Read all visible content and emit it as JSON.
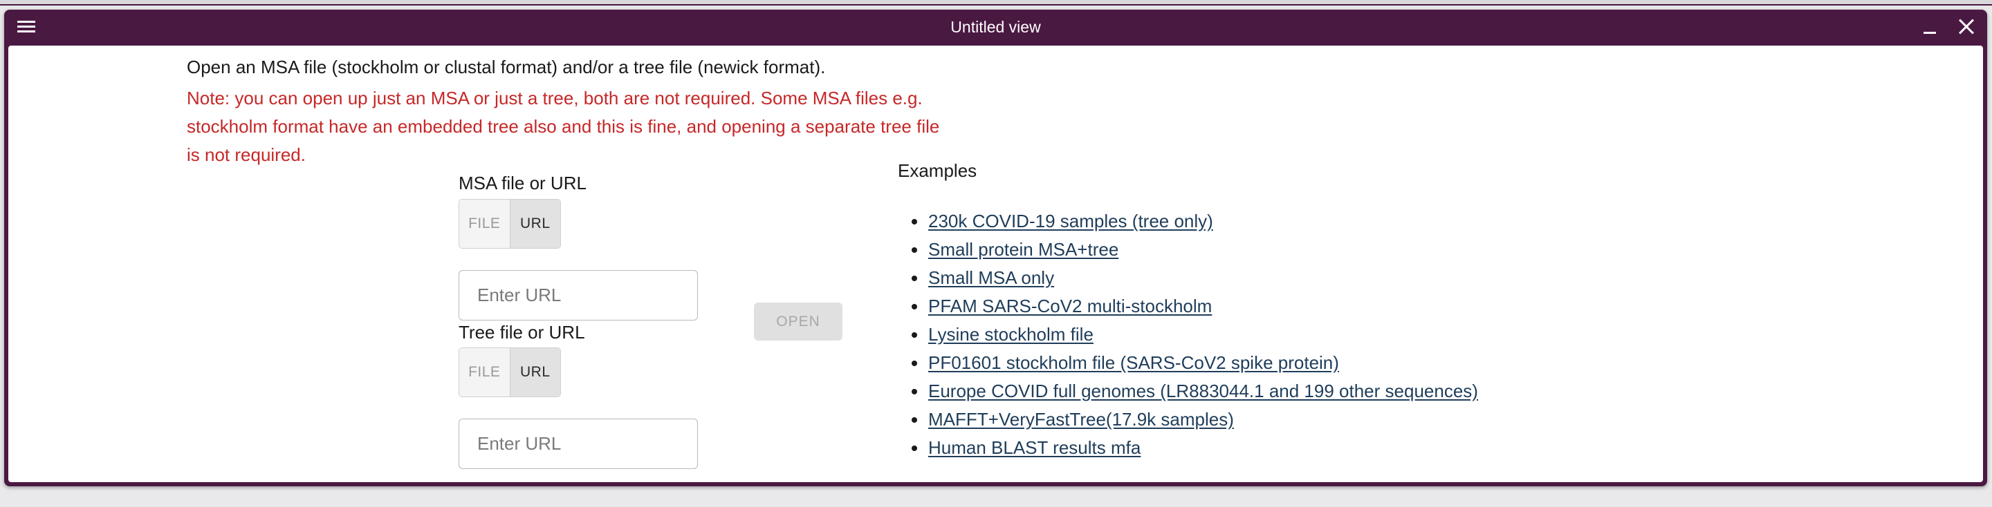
{
  "window": {
    "title": "Untitled view"
  },
  "intro": {
    "text": "Open an MSA file (stockholm or clustal format) and/or a tree file (newick format).",
    "note_lines": [
      "Note: you can open up just an MSA or just a tree, both are not required. Some MSA files e.g.",
      "stockholm format have an embedded tree also and this is fine, and opening a separate tree file",
      "is not required."
    ]
  },
  "msa": {
    "label": "MSA file or URL",
    "toggle": {
      "file_label": "FILE",
      "url_label": "URL",
      "selected": "URL"
    },
    "input": {
      "value": "",
      "placeholder": "Enter URL"
    }
  },
  "tree": {
    "label": "Tree file or URL",
    "toggle": {
      "file_label": "FILE",
      "url_label": "URL",
      "selected": "URL"
    },
    "input": {
      "value": "",
      "placeholder": "Enter URL"
    }
  },
  "open_button": {
    "label": "OPEN",
    "enabled": false
  },
  "examples": {
    "heading": "Examples",
    "items": [
      {
        "label": "230k COVID-19 samples (tree only)"
      },
      {
        "label": "Small protein MSA+tree"
      },
      {
        "label": "Small MSA only"
      },
      {
        "label": "PFAM SARS-CoV2 multi-stockholm"
      },
      {
        "label": "Lysine stockholm file"
      },
      {
        "label": "PF01601 stockholm file (SARS-CoV2 spike protein)"
      },
      {
        "label": "Europe COVID full genomes (LR883044.1 and 199 other sequences)"
      },
      {
        "label": "MAFFT+VeryFastTree(17.9k samples)"
      },
      {
        "label": "Human BLAST results mfa"
      }
    ]
  },
  "icons": {
    "menu": "hamburger-menu-icon",
    "minimize": "minimize-icon",
    "close": "close-icon"
  },
  "colors": {
    "titlebar": "#4a1942",
    "note_text": "#c62828",
    "link": "#1f3d5a"
  }
}
